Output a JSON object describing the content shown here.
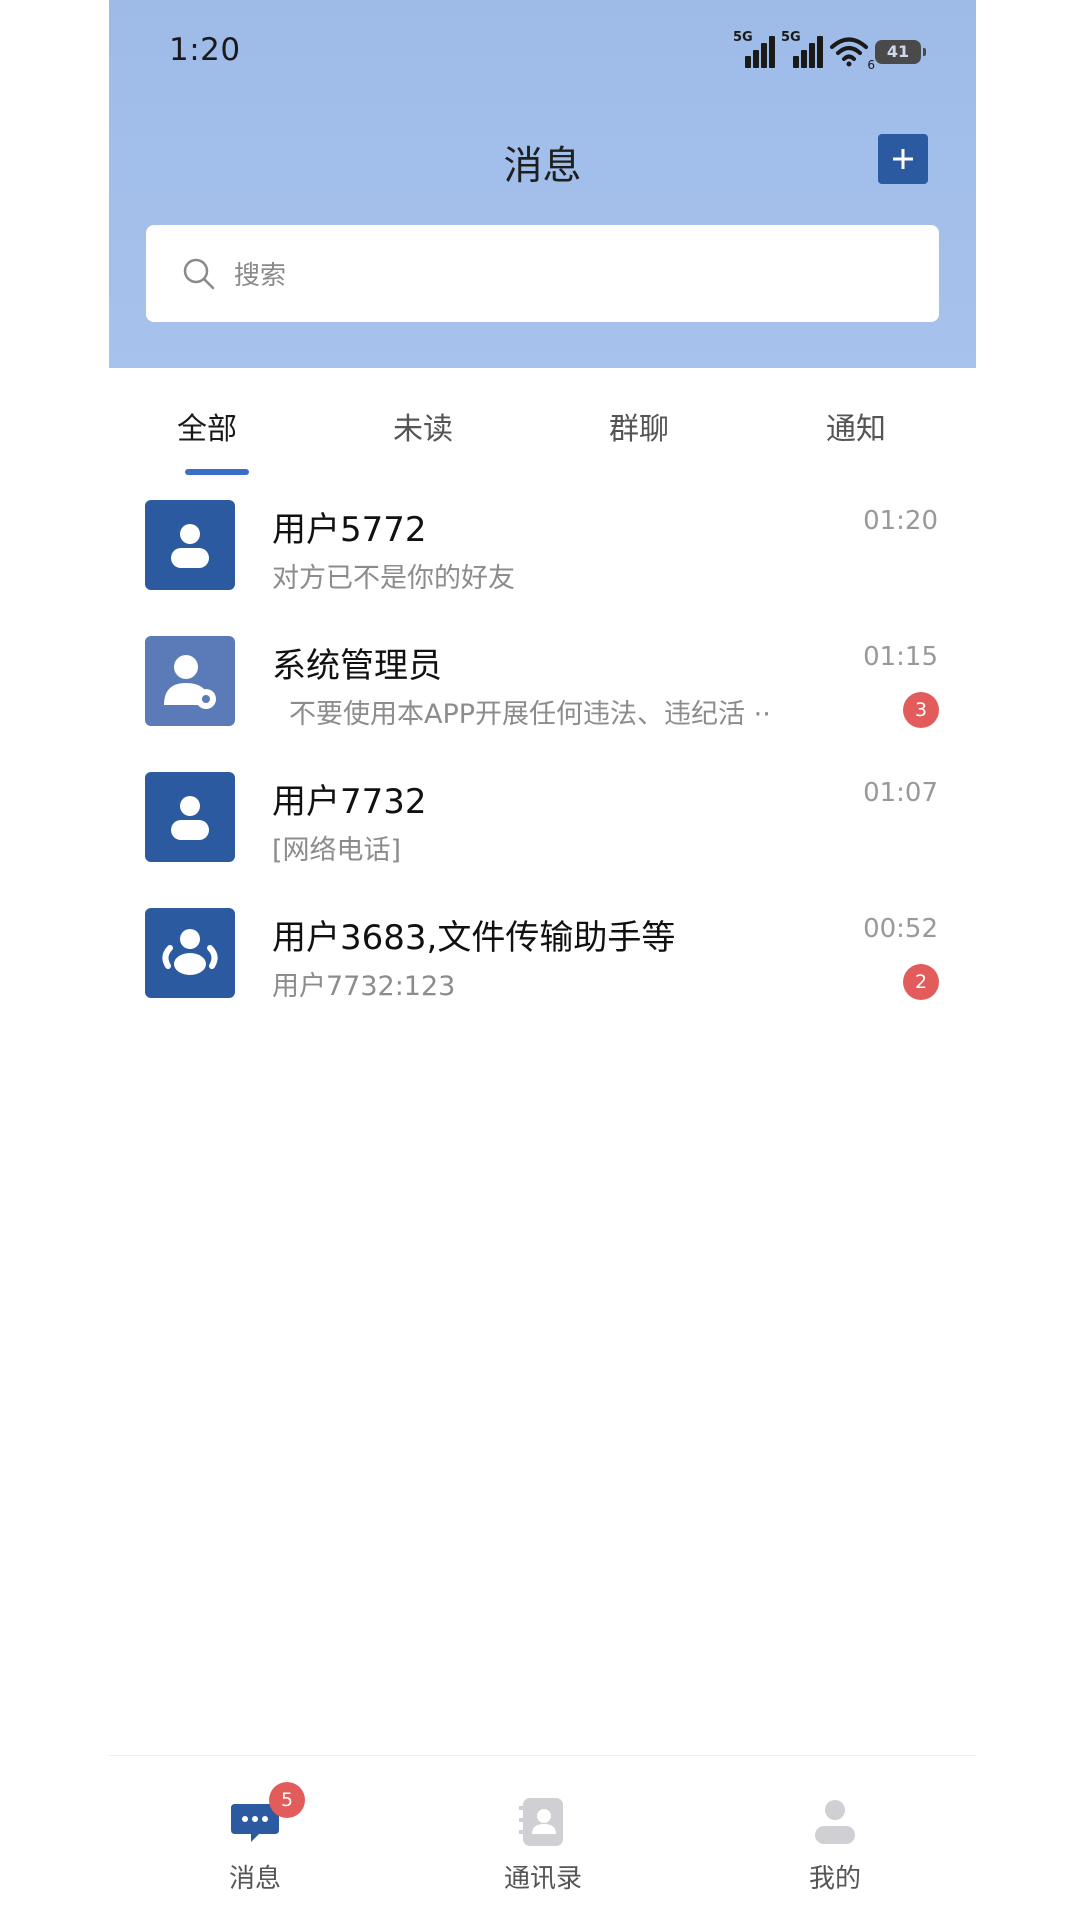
{
  "status_bar": {
    "time": "1:20",
    "network1": "5G",
    "network2": "5G",
    "wifi_sub": "6",
    "battery": "41"
  },
  "header": {
    "title": "消息",
    "add_icon": "plus-icon"
  },
  "search": {
    "placeholder": "搜索"
  },
  "tabs": [
    {
      "label": "全部",
      "active": true
    },
    {
      "label": "未读",
      "active": false
    },
    {
      "label": "群聊",
      "active": false
    },
    {
      "label": "通知",
      "active": false
    }
  ],
  "conversations": [
    {
      "name": "用户5772",
      "preview": "对方已不是你的好友",
      "time": "01:20",
      "avatar": "user-icon",
      "badge": null
    },
    {
      "name": "系统管理员",
      "preview": "不要使用本APP开展任何违法、违纪活 ··",
      "time": "01:15",
      "avatar": "admin-icon",
      "badge": "3"
    },
    {
      "name": "用户7732",
      "preview": "[网络电话]",
      "time": "01:07",
      "avatar": "user-icon",
      "badge": null
    },
    {
      "name": "用户3683,文件传输助手等",
      "preview": "用户7732:123",
      "time": "00:52",
      "avatar": "group-icon",
      "badge": "2"
    }
  ],
  "bottom_nav": [
    {
      "label": "消息",
      "icon": "chat-bubble-icon",
      "badge": "5",
      "active": true
    },
    {
      "label": "通讯录",
      "icon": "contacts-icon",
      "badge": null,
      "active": false
    },
    {
      "label": "我的",
      "icon": "profile-icon",
      "badge": null,
      "active": false
    }
  ],
  "colors": {
    "accent": "#2c5aa0",
    "header_bg": "#9ebbe8",
    "badge": "#e25c5c",
    "tab_indicator": "#3b6ec9"
  }
}
